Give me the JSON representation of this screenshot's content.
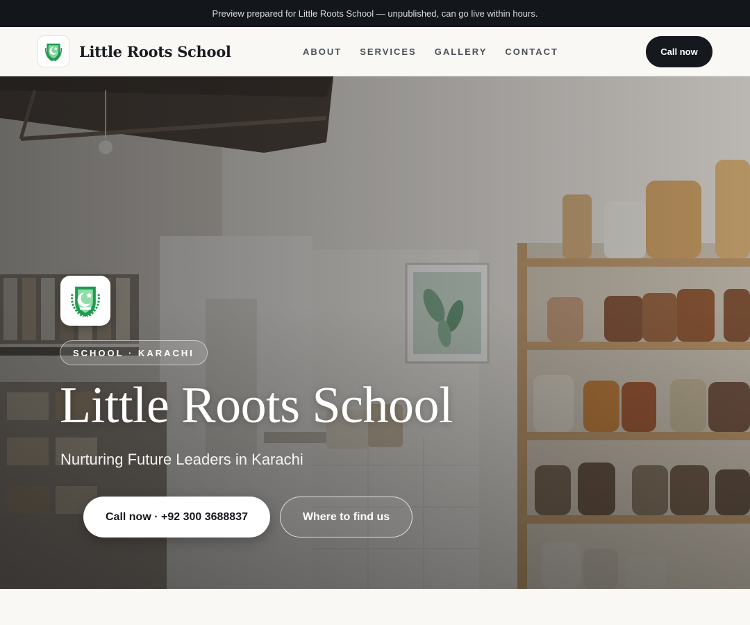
{
  "banner": {
    "text": "Preview prepared for Little Roots School — unpublished, can go live within hours."
  },
  "header": {
    "brand_name": "Little Roots School",
    "logo_icon": "school-crest-icon",
    "nav": [
      {
        "label": "ABOUT"
      },
      {
        "label": "SERVICES"
      },
      {
        "label": "GALLERY"
      },
      {
        "label": "CONTACT"
      }
    ],
    "cta_label": "Call now"
  },
  "hero": {
    "logo_icon": "school-crest-icon",
    "eyebrow": "SCHOOL · KARACHI",
    "title": "Little Roots School",
    "subtitle": "Nurturing Future Leaders in Karachi",
    "primary_cta": "Call now · +92 300 3688837",
    "secondary_cta": "Where to find us",
    "background_image": "shop-interior-shelves-with-jars-photo"
  },
  "colors": {
    "banner_bg": "#13161b",
    "page_bg": "#f9f8f5",
    "dark_button": "#15181d",
    "crest_green": "#1f9a4e"
  }
}
